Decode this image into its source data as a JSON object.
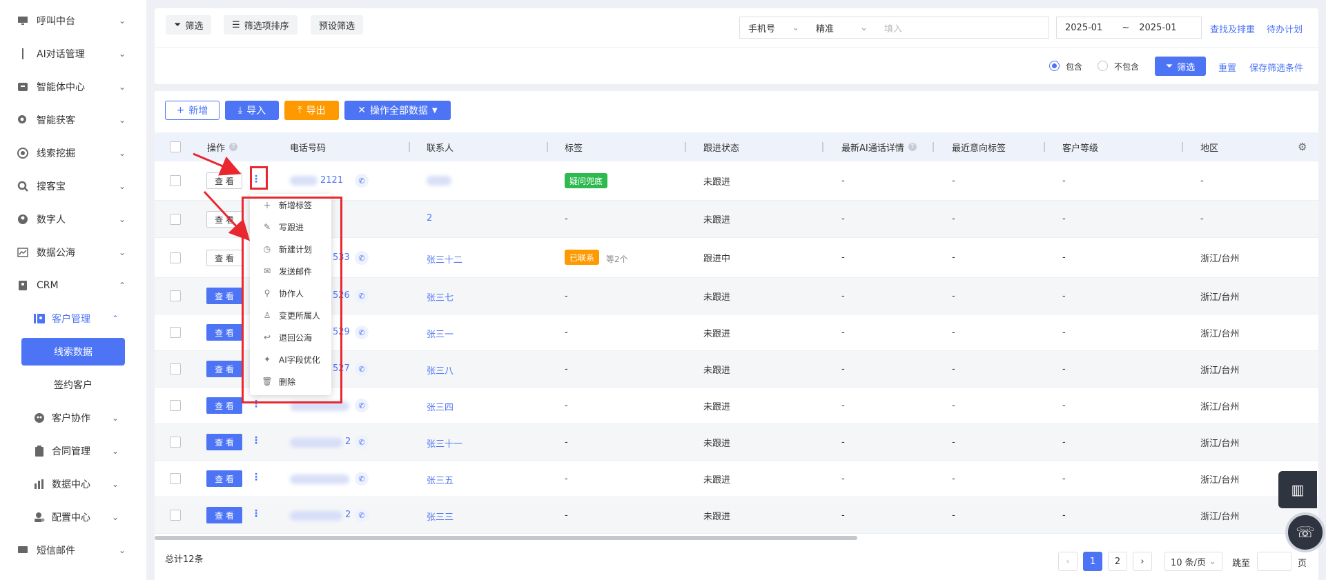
{
  "sidebar": {
    "items": [
      {
        "label": "呼叫中台",
        "icon": "monitor-icon"
      },
      {
        "label": "AI对话管理",
        "icon": "chat-icon"
      },
      {
        "label": "智能体中心",
        "icon": "box-icon"
      },
      {
        "label": "智能获客",
        "icon": "magnifier-icon"
      },
      {
        "label": "线索挖掘",
        "icon": "target-icon"
      },
      {
        "label": "搜客宝",
        "icon": "search-icon"
      },
      {
        "label": "数字人",
        "icon": "avatar-icon"
      },
      {
        "label": "数据公海",
        "icon": "chart-icon"
      },
      {
        "label": "CRM",
        "icon": "crm-icon"
      }
    ],
    "crm_children": [
      {
        "label": "客户管理",
        "icon": "customer-icon"
      },
      {
        "label": "客户协作",
        "icon": "collab-icon"
      },
      {
        "label": "合同管理",
        "icon": "clipboard-icon"
      },
      {
        "label": "数据中心",
        "icon": "bar-chart-icon"
      },
      {
        "label": "配置中心",
        "icon": "user-gear-icon"
      }
    ],
    "customer_children": [
      "线索数据",
      "签约客户"
    ],
    "bottom_items": [
      {
        "label": "短信邮件",
        "icon": "message-icon"
      }
    ]
  },
  "filter": {
    "filter_btn": "筛选",
    "sort_btn": "筛选项排序",
    "preset_btn": "预设筛选",
    "field_select": "手机号",
    "match_select": "精准",
    "input_placeholder": "填入",
    "date_start": "2025-01",
    "date_sep": "~",
    "date_end": "2025-01",
    "find_rank_link": "查找及排重",
    "todo_link": "待办计划",
    "include_label": "包含",
    "exclude_label": "不包含",
    "apply_btn": "筛选",
    "reset_link": "重置",
    "save_link": "保存筛选条件"
  },
  "actions": {
    "add": "新增",
    "import": "导入",
    "export": "导出",
    "bulk": "操作全部数据"
  },
  "table": {
    "headers": [
      "操作",
      "电话号码",
      "联系人",
      "标签",
      "跟进状态",
      "最新AI通话详情",
      "最近意向标签",
      "客户等级",
      "地区"
    ],
    "view_label": "查 看",
    "rows": [
      {
        "phone": "2121",
        "contact": "",
        "tag": "疑问兜底",
        "tag_color": "#2dba4e",
        "tag_extra": "",
        "status": "未跟进",
        "ai": "-",
        "intent": "-",
        "level": "-",
        "region": "-"
      },
      {
        "phone": "",
        "contact": "2",
        "tag": "-",
        "tag_color": "",
        "tag_extra": "",
        "status": "未跟进",
        "ai": "-",
        "intent": "-",
        "level": "-",
        "region": "-"
      },
      {
        "phone": "533",
        "contact": "张三十二",
        "tag": "已联系",
        "tag_color": "#ff9900",
        "tag_extra": "等2个",
        "status": "跟进中",
        "ai": "-",
        "intent": "-",
        "level": "-",
        "region": "浙江/台州"
      },
      {
        "phone": "526",
        "contact": "张三七",
        "tag": "-",
        "tag_color": "",
        "tag_extra": "",
        "status": "未跟进",
        "ai": "-",
        "intent": "-",
        "level": "-",
        "region": "浙江/台州"
      },
      {
        "phone": "529",
        "contact": "张三一",
        "tag": "-",
        "tag_color": "",
        "tag_extra": "",
        "status": "未跟进",
        "ai": "-",
        "intent": "-",
        "level": "-",
        "region": "浙江/台州"
      },
      {
        "phone": "527",
        "contact": "张三八",
        "tag": "-",
        "tag_color": "",
        "tag_extra": "",
        "status": "未跟进",
        "ai": "-",
        "intent": "-",
        "level": "-",
        "region": "浙江/台州"
      },
      {
        "phone": "",
        "contact": "张三四",
        "tag": "-",
        "tag_color": "",
        "tag_extra": "",
        "status": "未跟进",
        "ai": "-",
        "intent": "-",
        "level": "-",
        "region": "浙江/台州"
      },
      {
        "phone": "2",
        "contact": "张三十一",
        "tag": "-",
        "tag_color": "",
        "tag_extra": "",
        "status": "未跟进",
        "ai": "-",
        "intent": "-",
        "level": "-",
        "region": "浙江/台州"
      },
      {
        "phone": "",
        "contact": "张三五",
        "tag": "-",
        "tag_color": "",
        "tag_extra": "",
        "status": "未跟进",
        "ai": "-",
        "intent": "-",
        "level": "-",
        "region": "浙江/台州"
      },
      {
        "phone": "2",
        "contact": "张三三",
        "tag": "-",
        "tag_color": "",
        "tag_extra": "",
        "status": "未跟进",
        "ai": "-",
        "intent": "-",
        "level": "-",
        "region": "浙江/台州"
      }
    ]
  },
  "dropdown_menu": {
    "items": [
      {
        "label": "新增标签",
        "icon": "plus-icon"
      },
      {
        "label": "写跟进",
        "icon": "edit-icon"
      },
      {
        "label": "新建计划",
        "icon": "clock-icon"
      },
      {
        "label": "发送邮件",
        "icon": "mail-icon"
      },
      {
        "label": "协作人",
        "icon": "collaborator-icon"
      },
      {
        "label": "变更所属人",
        "icon": "change-owner-icon"
      },
      {
        "label": "退回公海",
        "icon": "return-icon"
      },
      {
        "label": "AI字段优化",
        "icon": "sparkle-icon"
      },
      {
        "label": "删除",
        "icon": "trash-icon"
      }
    ]
  },
  "footer": {
    "total": "总计12条",
    "pages": [
      "1",
      "2"
    ],
    "current_page": "1",
    "page_size": "10 条/页",
    "jump_label": "跳至",
    "page_suffix": "页"
  },
  "colors": {
    "primary": "#4d74f5",
    "warning": "#ff9900",
    "success": "#2dba4e",
    "annotation_red": "#e8282e"
  }
}
